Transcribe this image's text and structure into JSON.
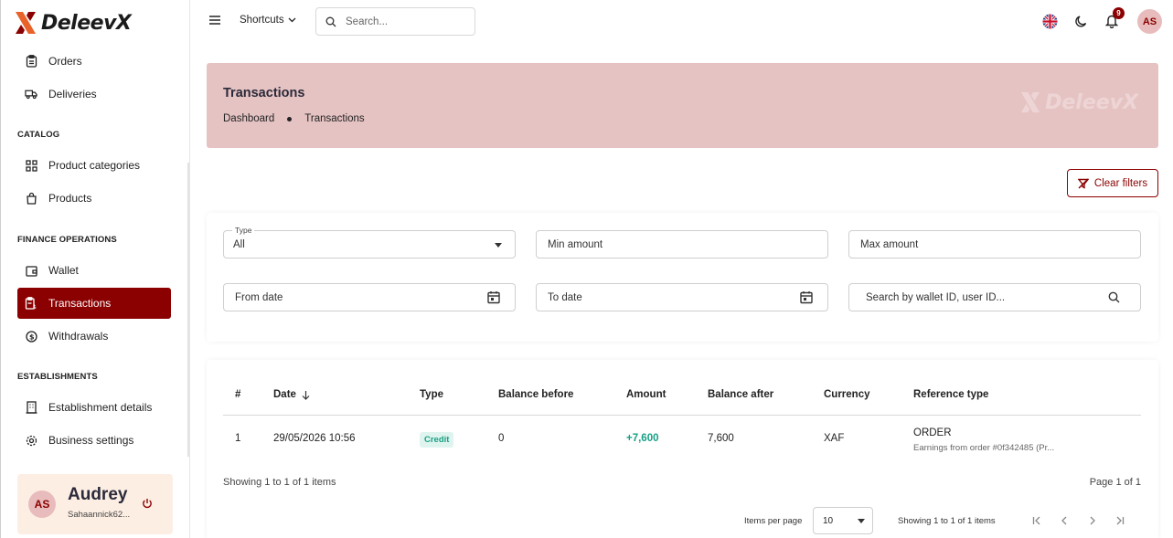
{
  "brand": {
    "name": "DeleevX",
    "accent": "#8b0000",
    "accent_dark": "#1b1b1b",
    "accent_orange": "#e8622a"
  },
  "sidebar": {
    "items_top": [
      {
        "label": "Orders",
        "icon": "clipboard-icon"
      },
      {
        "label": "Deliveries",
        "icon": "truck-icon"
      }
    ],
    "sections": [
      {
        "title": "CATALOG",
        "items": [
          {
            "label": "Product categories",
            "icon": "grid-icon"
          },
          {
            "label": "Products",
            "icon": "bag-icon"
          }
        ]
      },
      {
        "title": "FINANCE OPERATIONS",
        "items": [
          {
            "label": "Wallet",
            "icon": "wallet-icon"
          },
          {
            "label": "Transactions",
            "icon": "receipt-icon",
            "active": true
          },
          {
            "label": "Withdrawals",
            "icon": "dollar-circle-icon"
          }
        ]
      },
      {
        "title": "ESTABLISHMENTS",
        "items": [
          {
            "label": "Establishment details",
            "icon": "building-icon"
          },
          {
            "label": "Business settings",
            "icon": "gear-icon"
          }
        ]
      }
    ],
    "user": {
      "initials": "AS",
      "name": "Audrey",
      "email": "Sahaannick62..."
    }
  },
  "topbar": {
    "shortcuts_label": "Shortcuts",
    "search_placeholder": "Search...",
    "notification_count": "9",
    "avatar_initials": "AS"
  },
  "banner": {
    "title": "Transactions",
    "breadcrumb": [
      "Dashboard",
      "Transactions"
    ],
    "watermark": "DeleevX"
  },
  "filters": {
    "clear_label": "Clear filters",
    "type_label": "Type",
    "type_value": "All",
    "min_amount": "Min amount",
    "max_amount": "Max amount",
    "from_date": "From date",
    "to_date": "To date",
    "search_placeholder": "Search by wallet ID, user ID..."
  },
  "table": {
    "columns": [
      "#",
      "Date",
      "Type",
      "Balance before",
      "Amount",
      "Balance after",
      "Currency",
      "Reference type"
    ],
    "rows": [
      {
        "index": "1",
        "date": "29/05/2026 10:56",
        "type": "Credit",
        "balance_before": "0",
        "amount": "+7,600",
        "balance_after": "7,600",
        "currency": "XAF",
        "reference_type": "ORDER",
        "reference_detail": "Earnings from order #0f342485 (Pr..."
      }
    ],
    "showing_text": "Showing 1 to 1 of 1 items",
    "page_text": "Page 1 of 1",
    "items_per_page_label": "Items per page",
    "items_per_page_value": "10",
    "showing_text_small": "Showing 1 to 1 of 1 items"
  }
}
